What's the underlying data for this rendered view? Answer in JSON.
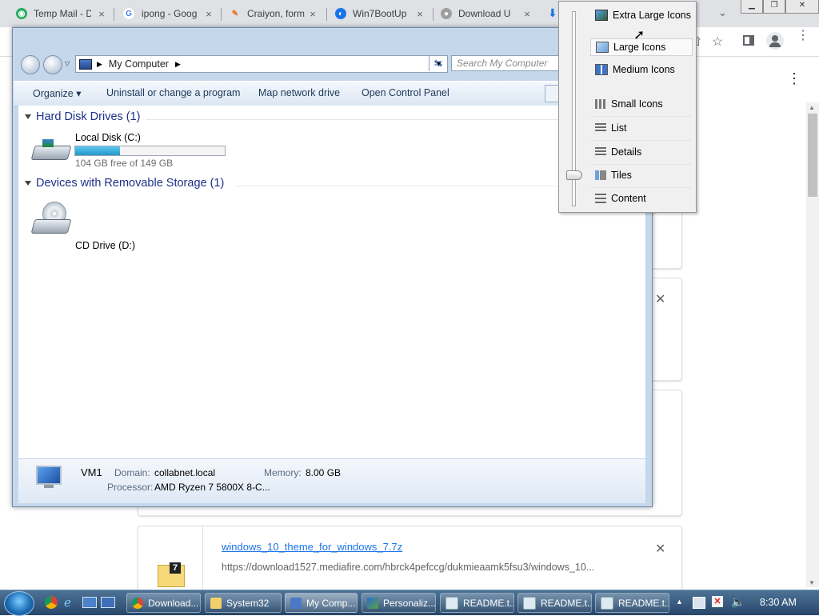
{
  "chrome": {
    "tabs": [
      {
        "title": "Temp Mail - D",
        "icon": "tempmail-favicon"
      },
      {
        "title": "ipong - Goog",
        "icon": "google-favicon"
      },
      {
        "title": "Craiyon, form",
        "icon": "craiyon-favicon"
      },
      {
        "title": "Win7BootUp",
        "icon": "win7bootup-favicon"
      },
      {
        "title": "Download U",
        "icon": "download-favicon"
      }
    ],
    "tab_close": "×"
  },
  "downloads_page": {
    "item": {
      "filename": "windows_10_theme_for_windows_7.7z",
      "url": "https://download1527.mediafire.com/hbrck4pefccg/dukmieaamk5fsu3/windows_10...",
      "icon_label": "7"
    }
  },
  "explorer": {
    "address": "My Computer",
    "search_placeholder": "Search My Computer",
    "commands": [
      "Organize ▾",
      "Uninstall or change a program",
      "Map network drive",
      "Open Control Panel"
    ],
    "groups": [
      {
        "title": "Hard Disk Drives (1)"
      },
      {
        "title": "Devices with Removable Storage (1)"
      }
    ],
    "drives": {
      "c": {
        "name": "Local Disk (C:)",
        "free": "104 GB free of 149 GB",
        "used_fraction": 0.3
      },
      "d": {
        "name": "CD Drive (D:)"
      }
    },
    "status": {
      "computer_name": "VM1",
      "domain_label": "Domain:",
      "domain": "collabnet.local",
      "memory_label": "Memory:",
      "memory": "8.00 GB",
      "processor_label": "Processor:",
      "processor": "AMD Ryzen 7 5800X 8-C..."
    }
  },
  "view_menu": {
    "items": [
      "Extra Large Icons",
      "Large Icons",
      "Medium Icons",
      "Small Icons",
      "List",
      "Details",
      "Tiles",
      "Content"
    ],
    "selected": "Tiles",
    "hovered": "Large Icons"
  },
  "taskbar": {
    "buttons": [
      "Download...",
      "System32",
      "My Comp...",
      "Personaliz...",
      "README.t...",
      "README.t...",
      "README.t..."
    ],
    "clock": "8:30 AM"
  }
}
